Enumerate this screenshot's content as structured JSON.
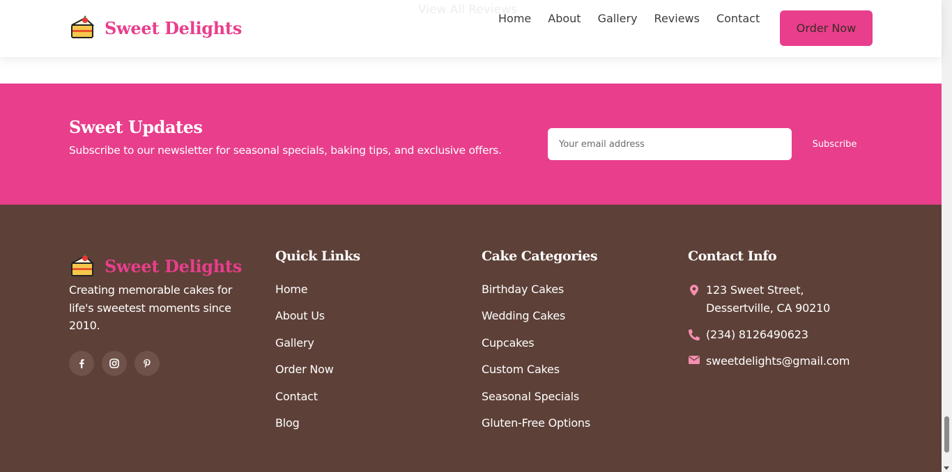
{
  "header": {
    "ghost_text": "View All Reviews",
    "brand": "Sweet Delights",
    "nav": [
      "Home",
      "About",
      "Gallery",
      "Reviews",
      "Contact"
    ],
    "order_label": "Order Now"
  },
  "newsletter": {
    "title": "Sweet Updates",
    "text": "Subscribe to our newsletter for seasonal specials, baking tips, and exclusive offers.",
    "placeholder": "Your email address",
    "button": "Subscribe"
  },
  "footer": {
    "brand": "Sweet Delights",
    "about": "Creating memorable cakes for life's sweetest moments since 2010.",
    "socials": [
      "facebook-icon",
      "instagram-icon",
      "pinterest-icon"
    ],
    "quick_links": {
      "title": "Quick Links",
      "items": [
        "Home",
        "About Us",
        "Gallery",
        "Order Now",
        "Contact",
        "Blog"
      ]
    },
    "categories": {
      "title": "Cake Categories",
      "items": [
        "Birthday Cakes",
        "Wedding Cakes",
        "Cupcakes",
        "Custom Cakes",
        "Seasonal Specials",
        "Gluten-Free Options"
      ]
    },
    "contact": {
      "title": "Contact Info",
      "address": "123 Sweet Street, Dessertville, CA 90210",
      "phone": "(234) 8126490623",
      "email": "sweetdelights@gmail.com"
    }
  },
  "colors": {
    "accent": "#e83e8c",
    "footer_bg": "#5d4037",
    "icon_pink": "#f48fb1"
  }
}
